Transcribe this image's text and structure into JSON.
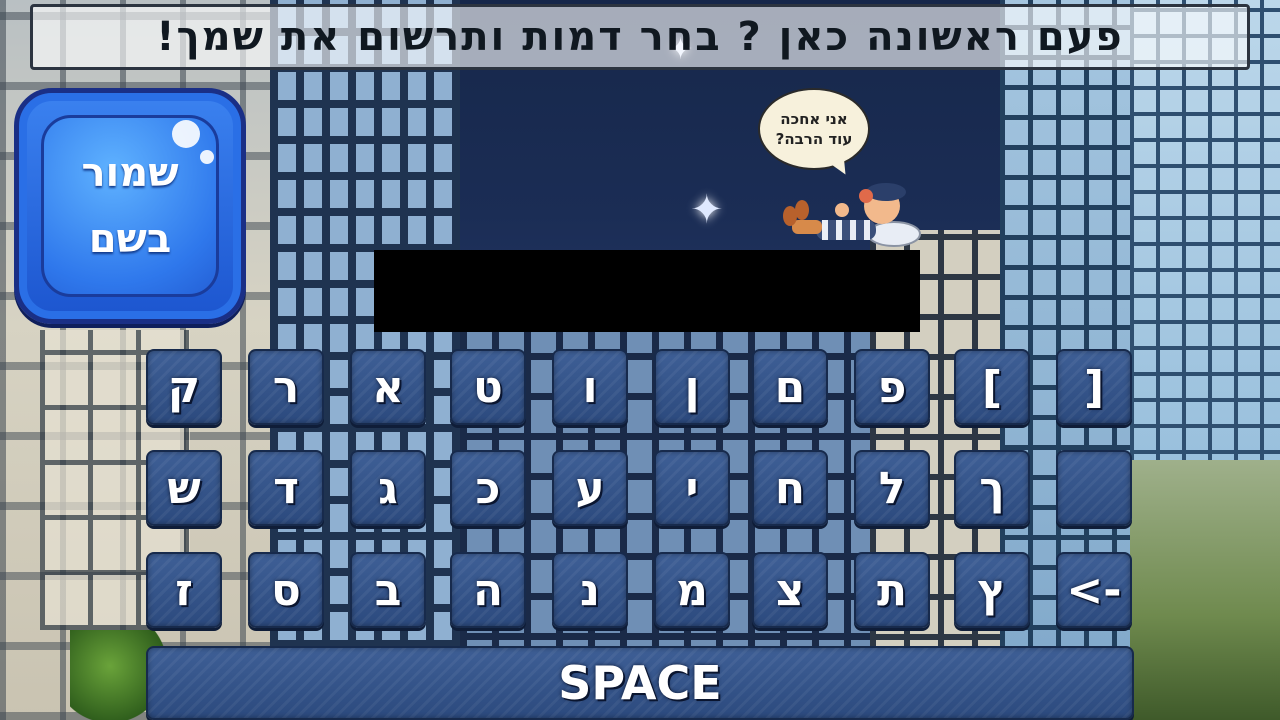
{
  "banner": {
    "text": "פעם ראשונה כאן ? בחר דמות ותרשום את שמך!"
  },
  "save_button": {
    "line1": "שמור",
    "line2": "בשם"
  },
  "speech_bubble": {
    "line1": "אני אחכה",
    "line2": "עוד הרבה?"
  },
  "name_display": {
    "value": ""
  },
  "keyboard": {
    "row1": [
      "ק",
      "ר",
      "א",
      "ט",
      "ו",
      "ן",
      "ם",
      "פ",
      "[",
      "]"
    ],
    "row2": [
      "ש",
      "ד",
      "ג",
      "כ",
      "ע",
      "י",
      "ח",
      "ל",
      "ך",
      ""
    ],
    "row3": [
      "ז",
      "ס",
      "ב",
      "ה",
      "נ",
      "מ",
      "צ",
      "ת",
      "ץ",
      "<-"
    ],
    "space_label": "SPACE"
  },
  "colors": {
    "key_fill": "#2f4f85",
    "save_button": "#2f78ec",
    "night_sky": "#1b2d55"
  },
  "icons": [
    "sparkle-star-icon",
    "sleeping-character"
  ]
}
